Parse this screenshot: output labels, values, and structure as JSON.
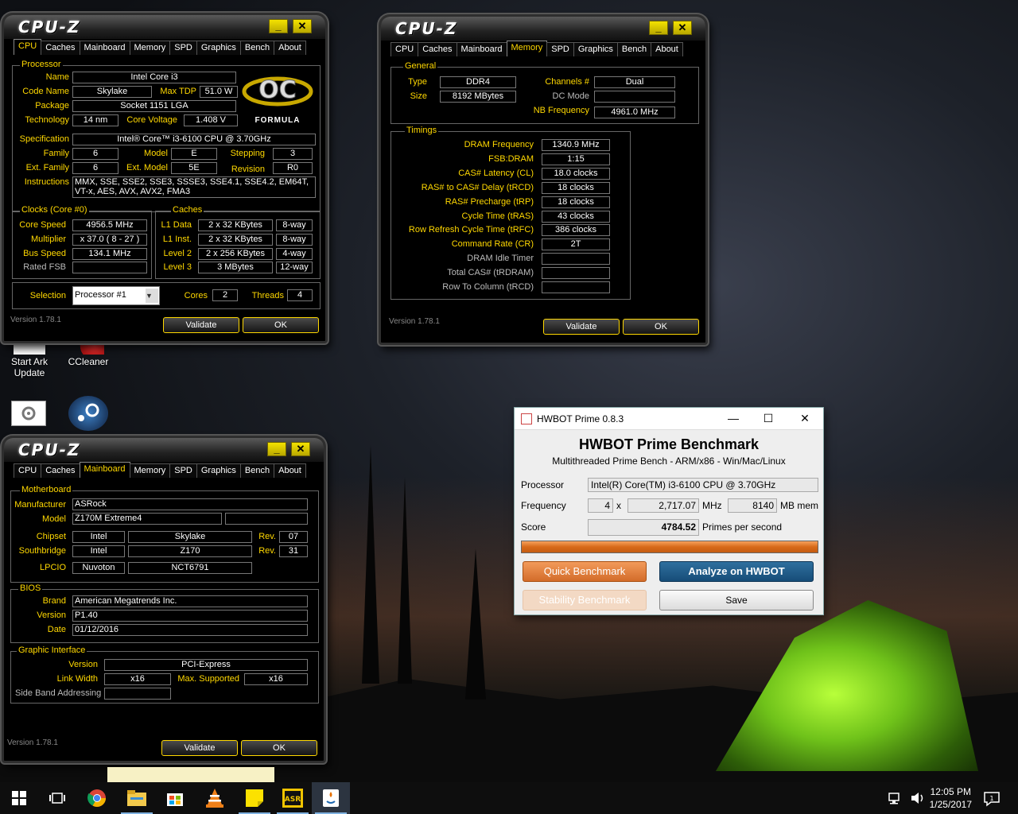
{
  "desktop": {
    "icons": [
      {
        "label": "Start Ark Update"
      },
      {
        "label": "CCleaner"
      }
    ]
  },
  "cpuz1": {
    "logo": "CPU-Z",
    "tabs": [
      "CPU",
      "Caches",
      "Mainboard",
      "Memory",
      "SPD",
      "Graphics",
      "Bench",
      "About"
    ],
    "processor_group": "Processor",
    "name_label": "Name",
    "name": "Intel Core i3",
    "codename_label": "Code Name",
    "codename": "Skylake",
    "maxtdp_label": "Max TDP",
    "maxtdp": "51.0 W",
    "package_label": "Package",
    "package": "Socket 1151 LGA",
    "tech_label": "Technology",
    "tech": "14 nm",
    "voltage_label": "Core Voltage",
    "voltage": "1.408 V",
    "spec_label": "Specification",
    "spec": "Intel® Core™ i3-6100 CPU @ 3.70GHz",
    "family_label": "Family",
    "family": "6",
    "model_label": "Model",
    "model": "E",
    "stepping_label": "Stepping",
    "stepping": "3",
    "extfamily_label": "Ext. Family",
    "extfamily": "6",
    "extmodel_label": "Ext. Model",
    "extmodel": "5E",
    "revision_label": "Revision",
    "revision": "R0",
    "instr_label": "Instructions",
    "instr": "MMX, SSE, SSE2, SSE3, SSSE3, SSE4.1, SSE4.2, EM64T, VT-x, AES, AVX, AVX2, FMA3",
    "oc_logo": "FORMULA",
    "clocks_group": "Clocks (Core #0)",
    "corespeed_label": "Core Speed",
    "corespeed": "4956.5 MHz",
    "multiplier_label": "Multiplier",
    "multiplier": "x 37.0 ( 8 - 27 )",
    "busspeed_label": "Bus Speed",
    "busspeed": "134.1 MHz",
    "ratedfsb_label": "Rated FSB",
    "caches_group": "Caches",
    "l1d_label": "L1 Data",
    "l1d": "2 x 32 KBytes",
    "l1d_way": "8-way",
    "l1i_label": "L1 Inst.",
    "l1i": "2 x 32 KBytes",
    "l1i_way": "8-way",
    "l2_label": "Level 2",
    "l2": "2 x 256 KBytes",
    "l2_way": "4-way",
    "l3_label": "Level 3",
    "l3": "3 MBytes",
    "l3_way": "12-way",
    "selection_label": "Selection",
    "selection": "Processor #1",
    "cores_label": "Cores",
    "cores": "2",
    "threads_label": "Threads",
    "threads": "4",
    "version": "Version 1.78.1",
    "validate": "Validate",
    "ok": "OK"
  },
  "cpuz2": {
    "logo": "CPU-Z",
    "tabs": [
      "CPU",
      "Caches",
      "Mainboard",
      "Memory",
      "SPD",
      "Graphics",
      "Bench",
      "About"
    ],
    "general_group": "General",
    "type_label": "Type",
    "type": "DDR4",
    "size_label": "Size",
    "size": "8192 MBytes",
    "channels_label": "Channels #",
    "channels": "Dual",
    "dcmode_label": "DC Mode",
    "nbfreq_label": "NB Frequency",
    "nbfreq": "4961.0 MHz",
    "timings_group": "Timings",
    "timings": [
      {
        "label": "DRAM Frequency",
        "value": "1340.9 MHz"
      },
      {
        "label": "FSB:DRAM",
        "value": "1:15"
      },
      {
        "label": "CAS# Latency (CL)",
        "value": "18.0 clocks"
      },
      {
        "label": "RAS# to CAS# Delay (tRCD)",
        "value": "18 clocks"
      },
      {
        "label": "RAS# Precharge (tRP)",
        "value": "18 clocks"
      },
      {
        "label": "Cycle Time (tRAS)",
        "value": "43 clocks"
      },
      {
        "label": "Row Refresh Cycle Time (tRFC)",
        "value": "386 clocks"
      },
      {
        "label": "Command Rate (CR)",
        "value": "2T"
      },
      {
        "label": "DRAM Idle Timer",
        "value": ""
      },
      {
        "label": "Total CAS# (tRDRAM)",
        "value": ""
      },
      {
        "label": "Row To Column (tRCD)",
        "value": ""
      }
    ],
    "version": "Version 1.78.1",
    "validate": "Validate",
    "ok": "OK"
  },
  "cpuz3": {
    "logo": "CPU-Z",
    "tabs": [
      "CPU",
      "Caches",
      "Mainboard",
      "Memory",
      "SPD",
      "Graphics",
      "Bench",
      "About"
    ],
    "mb_group": "Motherboard",
    "manufacturer_label": "Manufacturer",
    "manufacturer": "ASRock",
    "model_label": "Model",
    "model": "Z170M Extreme4",
    "chipset_label": "Chipset",
    "chipset_vendor": "Intel",
    "chipset_name": "Skylake",
    "chipset_rev_label": "Rev.",
    "chipset_rev": "07",
    "south_label": "Southbridge",
    "south_vendor": "Intel",
    "south_name": "Z170",
    "south_rev_label": "Rev.",
    "south_rev": "31",
    "lpcio_label": "LPCIO",
    "lpcio_vendor": "Nuvoton",
    "lpcio_name": "NCT6791",
    "bios_group": "BIOS",
    "brand_label": "Brand",
    "brand": "American Megatrends Inc.",
    "version_label": "Version",
    "bios_version": "P1.40",
    "date_label": "Date",
    "date": "01/12/2016",
    "gi_group": "Graphic Interface",
    "gi_version_label": "Version",
    "gi_version": "PCI-Express",
    "linkwidth_label": "Link Width",
    "linkwidth": "x16",
    "maxsup_label": "Max. Supported",
    "maxsup": "x16",
    "sideband_label": "Side Band Addressing",
    "version": "Version 1.78.1",
    "validate": "Validate",
    "ok": "OK"
  },
  "hwbot": {
    "title": "HWBOT Prime 0.8.3",
    "heading": "HWBOT Prime Benchmark",
    "subheading": "Multithreaded Prime Bench - ARM/x86 - Win/Mac/Linux",
    "processor_label": "Processor",
    "processor": "Intel(R) Core(TM) i3-6100 CPU @ 3.70GHz",
    "frequency_label": "Frequency",
    "threads": "4",
    "x": "x",
    "freq": "2,717.07",
    "mhz": "MHz",
    "mem": "8140",
    "mem_unit": "MB mem",
    "score_label": "Score",
    "score": "4784.52",
    "score_unit": "Primes per second",
    "progress": 1.0,
    "quick_btn": "Quick Benchmark",
    "analyze_btn": "Analyze on HWBOT",
    "stability_btn": "Stability Benchmark",
    "save_btn": "Save"
  },
  "taskbar": {
    "time": "12:05 PM",
    "date": "1/25/2017",
    "apps": [
      "start-icon",
      "task-view-icon",
      "chrome-icon",
      "file-explorer-icon",
      "store-icon",
      "vlc-icon",
      "sticky-notes-icon",
      "asrock-cpu-icon",
      "java-icon"
    ]
  }
}
